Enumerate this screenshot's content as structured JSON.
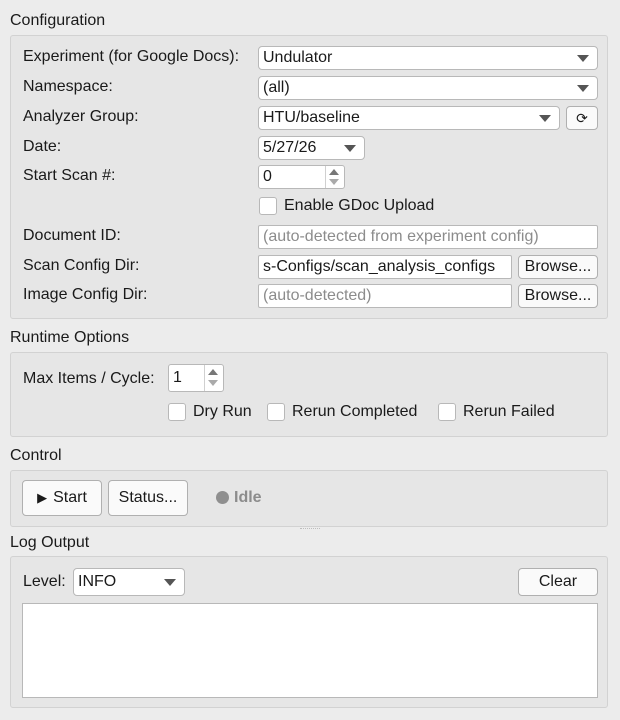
{
  "configuration": {
    "title": "Configuration",
    "experiment": {
      "label": "Experiment (for Google Docs):",
      "value": "Undulator"
    },
    "namespace": {
      "label": "Namespace:",
      "value": "(all)"
    },
    "analyzer_group": {
      "label": "Analyzer Group:",
      "value": "HTU/baseline",
      "refresh_icon": "⟳"
    },
    "date": {
      "label": "Date:",
      "value": "5/27/26"
    },
    "start_scan": {
      "label": "Start Scan #:",
      "value": "0"
    },
    "enable_gdoc": {
      "label": "Enable GDoc Upload",
      "checked": false
    },
    "document_id": {
      "label": "Document ID:",
      "placeholder": "(auto-detected from experiment config)"
    },
    "scan_config_dir": {
      "label": "Scan Config Dir:",
      "value": "s-Configs/scan_analysis_configs",
      "browse": "Browse..."
    },
    "image_config_dir": {
      "label": "Image Config Dir:",
      "placeholder": "(auto-detected)",
      "browse": "Browse..."
    }
  },
  "runtime": {
    "title": "Runtime Options",
    "max_items": {
      "label": "Max Items / Cycle:",
      "value": "1"
    },
    "dry_run": {
      "label": "Dry Run",
      "checked": false
    },
    "rerun_completed": {
      "label": "Rerun Completed",
      "checked": false
    },
    "rerun_failed": {
      "label": "Rerun Failed",
      "checked": false
    }
  },
  "control": {
    "title": "Control",
    "start_icon": "▶",
    "start_label": "Start",
    "status_label": "Status...",
    "state_label": "Idle",
    "state_color": "#8f8f8f"
  },
  "log": {
    "title": "Log Output",
    "level_label": "Level:",
    "level_value": "INFO",
    "clear_label": "Clear",
    "text": ""
  }
}
